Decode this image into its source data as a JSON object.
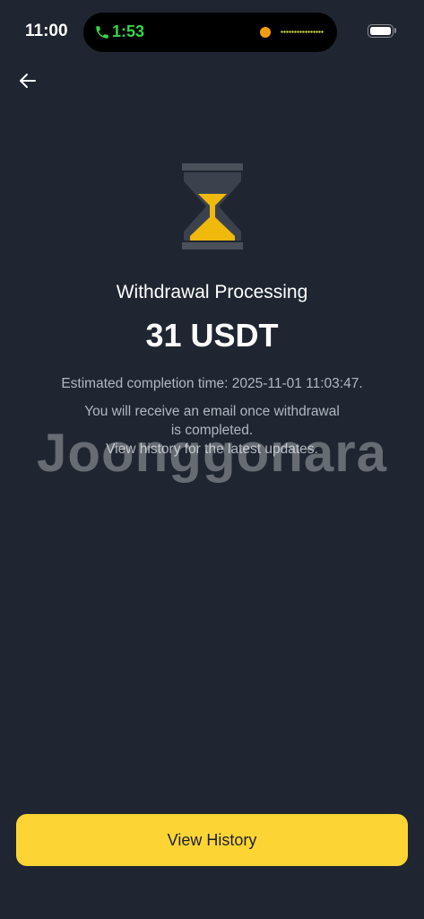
{
  "status_bar": {
    "time": "11:00",
    "call_duration": "1:53",
    "call_color": "#32d74b",
    "battery_level": 1.0
  },
  "header": {
    "back_icon": "arrow-left-icon"
  },
  "result": {
    "icon": "hourglass-icon",
    "icon_color": "#f0b90b",
    "title": "Withdrawal Processing",
    "amount": "31 USDT",
    "estimated_time": "Estimated completion time: 2025-11-01 11:03:47.",
    "info_lines": [
      "You will receive an email once withdrawal",
      "is completed.",
      "View history for the latest updates."
    ]
  },
  "watermark": "Joonggonara",
  "footer": {
    "button_label": "View History",
    "button_color": "#fcd535"
  },
  "colors": {
    "background": "#1f2631",
    "secondary_text": "#b2b7c0"
  }
}
